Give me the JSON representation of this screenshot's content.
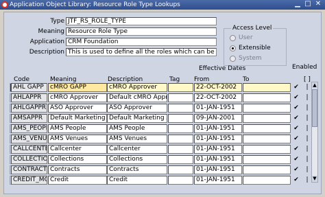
{
  "window": {
    "title": "Application Object Library: Resource Role Type Lookups"
  },
  "header": {
    "type_label": "Type",
    "type_value": "JTF_RS_ROLE_TYPE",
    "meaning_label": "Meaning",
    "meaning_value": "Resource Role Type",
    "application_label": "Application",
    "application_value": "CRM Foundation",
    "description_label": "Description",
    "description_value": "This is used to define all the roles  which can be assigned to"
  },
  "access_level": {
    "title": "Access Level",
    "options": [
      {
        "label": "User",
        "selected": false
      },
      {
        "label": "Extensible",
        "selected": true
      },
      {
        "label": "System",
        "selected": false
      }
    ]
  },
  "table": {
    "effective_dates_label": "Effective Dates",
    "enabled_label": "Enabled",
    "bracket_label": "[ ]",
    "columns": {
      "code": "Code",
      "meaning": "Meaning",
      "description": "Description",
      "tag": "Tag",
      "from": "From",
      "to": "To"
    },
    "rows": [
      {
        "code": "AHL GAPP",
        "meaning": "cMRO GAPP",
        "description": "cMRO Approver",
        "tag": "",
        "from": "22-OCT-2002",
        "to": "",
        "enabled": "✔"
      },
      {
        "code": "AHLAPPR",
        "meaning": "cMRO Approver",
        "description": "Default cMRO Approver",
        "tag": "",
        "from": "22-OCT-2002",
        "to": "",
        "enabled": "✔"
      },
      {
        "code": "AHLGAPPR",
        "meaning": "ASO Approver",
        "description": "ASO Approver",
        "tag": "",
        "from": "01-JAN-1951",
        "to": "",
        "enabled": "✔"
      },
      {
        "code": "AMSAPPR",
        "meaning": "Default Marketing App",
        "description": "Default Marketing Appro",
        "tag": "",
        "from": "09-JAN-2001",
        "to": "",
        "enabled": "✔"
      },
      {
        "code": "AMS_PEOPLI",
        "meaning": "AMS People",
        "description": "AMS People",
        "tag": "",
        "from": "01-JAN-1951",
        "to": "",
        "enabled": "✔"
      },
      {
        "code": "AMS_VENUE",
        "meaning": "AMS Venues",
        "description": "AMS Venues",
        "tag": "",
        "from": "01-JAN-1951",
        "to": "",
        "enabled": "✔"
      },
      {
        "code": "CALLCENTER",
        "meaning": "Callcenter",
        "description": "Callcenter",
        "tag": "",
        "from": "01-JAN-1951",
        "to": "",
        "enabled": "✔"
      },
      {
        "code": "COLLECTIONS",
        "meaning": "Collections",
        "description": "Collections",
        "tag": "",
        "from": "01-JAN-1951",
        "to": "",
        "enabled": "✔"
      },
      {
        "code": "CONTRACTS",
        "meaning": "Contracts",
        "description": "Contracts",
        "tag": "",
        "from": "01-JAN-1951",
        "to": "",
        "enabled": "✔"
      },
      {
        "code": "CREDIT_MGM",
        "meaning": "Credit",
        "description": "Credit",
        "tag": "",
        "from": "01-JAN-1951",
        "to": "",
        "enabled": "✔"
      }
    ]
  },
  "icons": {
    "app": "oracle-o-icon",
    "minimize": "minimize-icon",
    "maximize": "maximize-icon",
    "close": "close-icon"
  },
  "colors": {
    "titlebar": "#2e4e8e",
    "panel": "#cfd5e3",
    "highlight": "#fff9c8",
    "current_row": "#1e3a8a"
  }
}
